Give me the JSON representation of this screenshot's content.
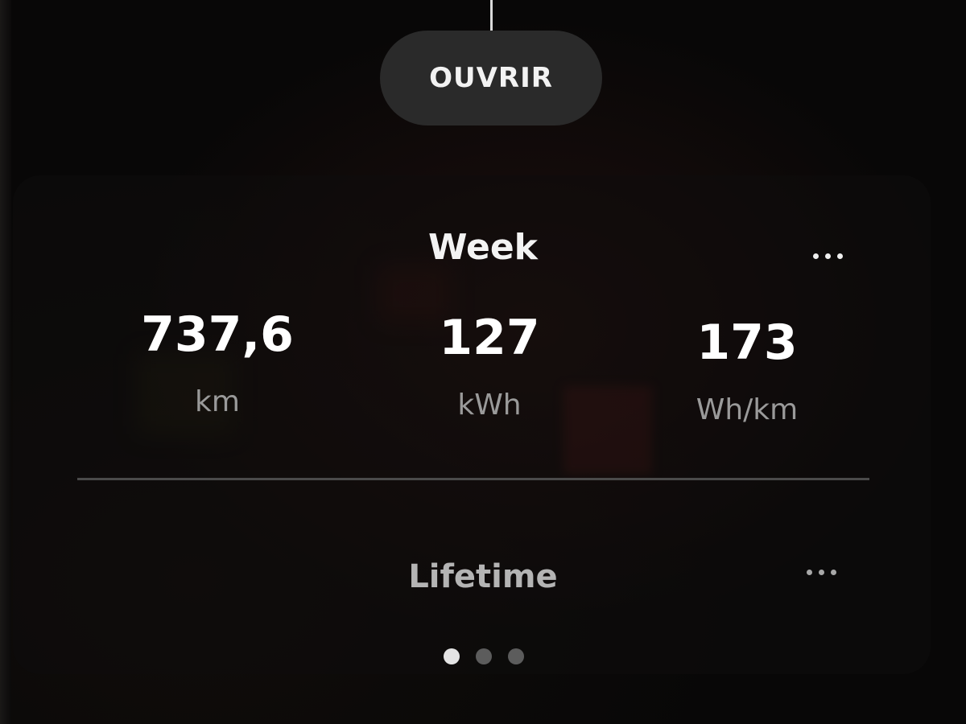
{
  "open_button": {
    "label": "OUVRIR"
  },
  "week": {
    "title": "Week",
    "stats": [
      {
        "value": "737,6",
        "unit": "km"
      },
      {
        "value": "127",
        "unit": "kWh"
      },
      {
        "value": "173",
        "unit": "Wh/km"
      }
    ]
  },
  "lifetime": {
    "title": "Lifetime"
  },
  "more_icon": "more-horizontal-icon",
  "pager": {
    "count": 3,
    "active_index": 0
  },
  "colors": {
    "background": "#080707",
    "button_bg": "#2a2a2a",
    "text_primary": "#ffffff",
    "text_secondary": "#9a9a9a"
  }
}
